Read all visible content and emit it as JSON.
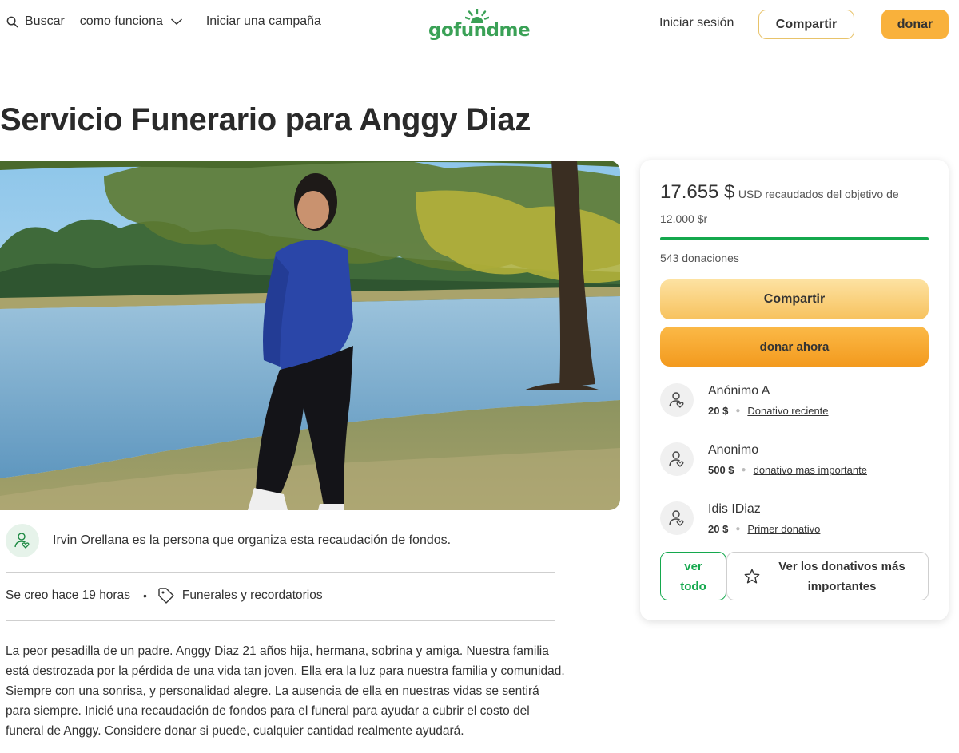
{
  "header": {
    "search_label": "Buscar",
    "how_label": "como funciona",
    "start_label": "Iniciar una campaña",
    "logo_text": "gofundme",
    "signin_label": "Iniciar sesión",
    "share_label": "Compartir",
    "donate_label": "donar"
  },
  "campaign": {
    "title": "Servicio Funerario para Anggy Diaz",
    "organizer_text": "Irvin Orellana es la persona que organiza esta recaudación de fondos.",
    "created": "Se creo hace 19 horas",
    "category": "Funerales y recordatorios",
    "story": "La peor pesadilla de un padre. Anggy Diaz 21 años hija, hermana, sobrina y amiga. Nuestra familia está destrozada por la pérdida de una vida tan joven. Ella era la luz para nuestra familia y comunidad. Siempre con una sonrisa, y personalidad alegre. La ausencia de ella en nuestras vidas se sentirá para siempre. Inicié una recaudación de fondos para el funeral para ayudar a cubrir el costo del funeral de Anggy. Considere donar si puede, cualquier cantidad realmente ayudará."
  },
  "sidebar": {
    "raised_amount": "17.655 $",
    "raised_text": "USD recaudados del objetivo de 12.000 $r",
    "progress_fraction": 1.0,
    "donations_count": "543 donaciones",
    "share_label": "Compartir",
    "donate_label": "donar ahora",
    "donors": [
      {
        "name": "Anónimo A",
        "amount": "20 $",
        "label": "Donativo reciente"
      },
      {
        "name": "Anonimo",
        "amount": "500 $",
        "label": "donativo mas importante"
      },
      {
        "name": "Idis IDiaz",
        "amount": "20 $",
        "label": "Primer donativo"
      }
    ],
    "see_all_label": "ver todo",
    "top_label": "Ver los donativos más importantes"
  },
  "colors": {
    "brand_green": "#14a84d",
    "donate_orange": "#f9b13b",
    "share_yellow": "#f7c25e"
  },
  "icons": [
    "search-icon",
    "chevron-down-icon",
    "gofundme-logo",
    "organizer-icon",
    "tag-icon",
    "donor-icon",
    "star-icon"
  ]
}
